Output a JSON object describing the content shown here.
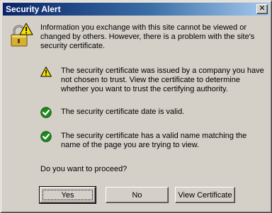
{
  "window": {
    "title": "Security Alert",
    "close_glyph": "✕"
  },
  "intro": {
    "icon": "lock-warning-icon",
    "text": "Information you exchange with this site cannot be viewed or changed by others. However, there is a problem with the site's security certificate."
  },
  "checks": [
    {
      "icon": "warning-icon",
      "status_color": "#f8e000",
      "text": "The security certificate was issued by a company you have not chosen to trust. View the certificate to determine whether you want to trust the certifying authority."
    },
    {
      "icon": "check-icon",
      "status_color": "#1e8a1e",
      "text": "The security certificate date is valid."
    },
    {
      "icon": "check-icon",
      "status_color": "#1e8a1e",
      "text": "The security certificate has a valid name matching the name of the page you are trying to view."
    }
  ],
  "question": "Do you want to proceed?",
  "buttons": {
    "yes": "Yes",
    "no": "No",
    "view_certificate": "View Certificate"
  },
  "colors": {
    "titlebar_start": "#0a246a",
    "titlebar_end": "#a6caf0",
    "face": "#d4d0c8"
  }
}
